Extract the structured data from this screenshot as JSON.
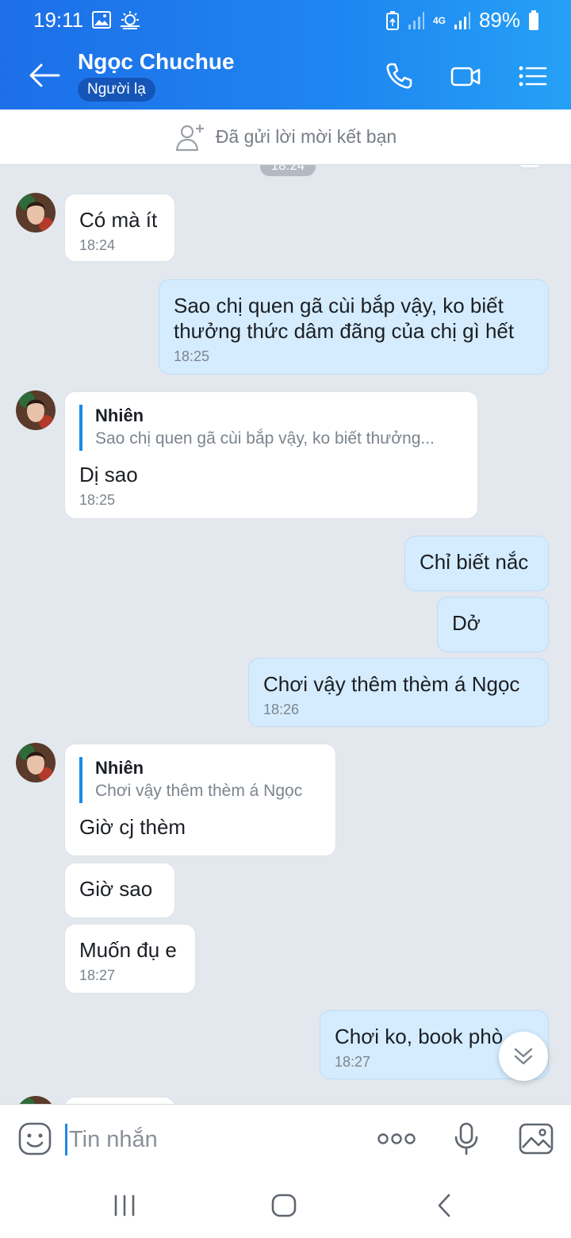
{
  "status_bar": {
    "time": "19:11",
    "battery": "89%",
    "network": "4G"
  },
  "header": {
    "contact_name": "Ngọc Chuchue",
    "badge": "Người lạ"
  },
  "friend_request": {
    "text": "Đã gửi lời mời kết bạn"
  },
  "chat": {
    "top_time_chip": "18:24",
    "messages": [
      {
        "dir": "in",
        "text": "Có mà ít",
        "time": "18:24"
      },
      {
        "dir": "out",
        "lines": [
          "Sao chị quen gã cùi bắp vậy, ko biết",
          "thưởng thức dâm đãng của chị gì hết"
        ],
        "time": "18:25"
      },
      {
        "dir": "in",
        "quote_name": "Nhiên",
        "quote_text": "Sao chị quen gã cùi bắp vậy, ko biết thưởng...",
        "text": "Dị sao",
        "time": "18:25"
      },
      {
        "dir": "out",
        "text": "Chỉ biết nắc"
      },
      {
        "dir": "out",
        "text": "Dở"
      },
      {
        "dir": "out",
        "text": "Chơi vậy thêm thèm á Ngọc",
        "time": "18:26"
      },
      {
        "dir": "in",
        "quote_name": "Nhiên",
        "quote_text": "Chơi vậy thêm thèm á Ngọc",
        "text": "Giờ cj thèm"
      },
      {
        "dir": "in",
        "text": "Giờ sao"
      },
      {
        "dir": "in",
        "text": "Muốn đụ e",
        "time": "18:27"
      },
      {
        "dir": "out",
        "text": "Chơi ko, book phò",
        "time": "18:27"
      }
    ]
  },
  "input": {
    "placeholder": "Tin nhắn"
  },
  "colors": {
    "header": "#1e86f0",
    "out_bubble": "#d5ecff",
    "in_bubble": "#ffffff",
    "chat_bg": "#e3e8ee",
    "accent": "#1e88e5"
  }
}
